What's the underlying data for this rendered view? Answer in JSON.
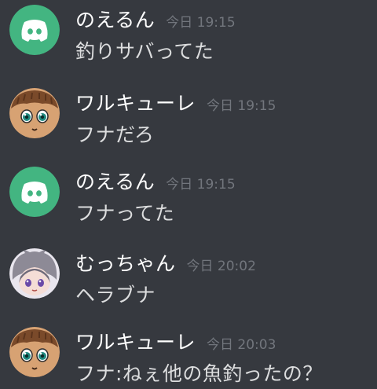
{
  "messages": [
    {
      "author": "のえるん",
      "timestamp": "今日 19:15",
      "text": "釣りサバってた",
      "avatar": "discord-default-avatar"
    },
    {
      "author": "ワルキューレ",
      "timestamp": "今日 19:15",
      "text": "フナだろ",
      "avatar": "anime-face-avatar"
    },
    {
      "author": "のえるん",
      "timestamp": "今日 19:15",
      "text": "フナってた",
      "avatar": "discord-default-avatar"
    },
    {
      "author": "むっちゃん",
      "timestamp": "今日 20:02",
      "text": "ヘラブナ",
      "avatar": "anime-girl-avatar"
    },
    {
      "author": "ワルキューレ",
      "timestamp": "今日 20:03",
      "text": "フナ:ねぇ他の魚釣ったの？",
      "avatar": "anime-face-avatar"
    }
  ],
  "colors": {
    "background": "#36393f",
    "discord_green": "#43b581",
    "username": "#ffffff",
    "timestamp": "#72767d",
    "message_text": "#dcddde"
  }
}
